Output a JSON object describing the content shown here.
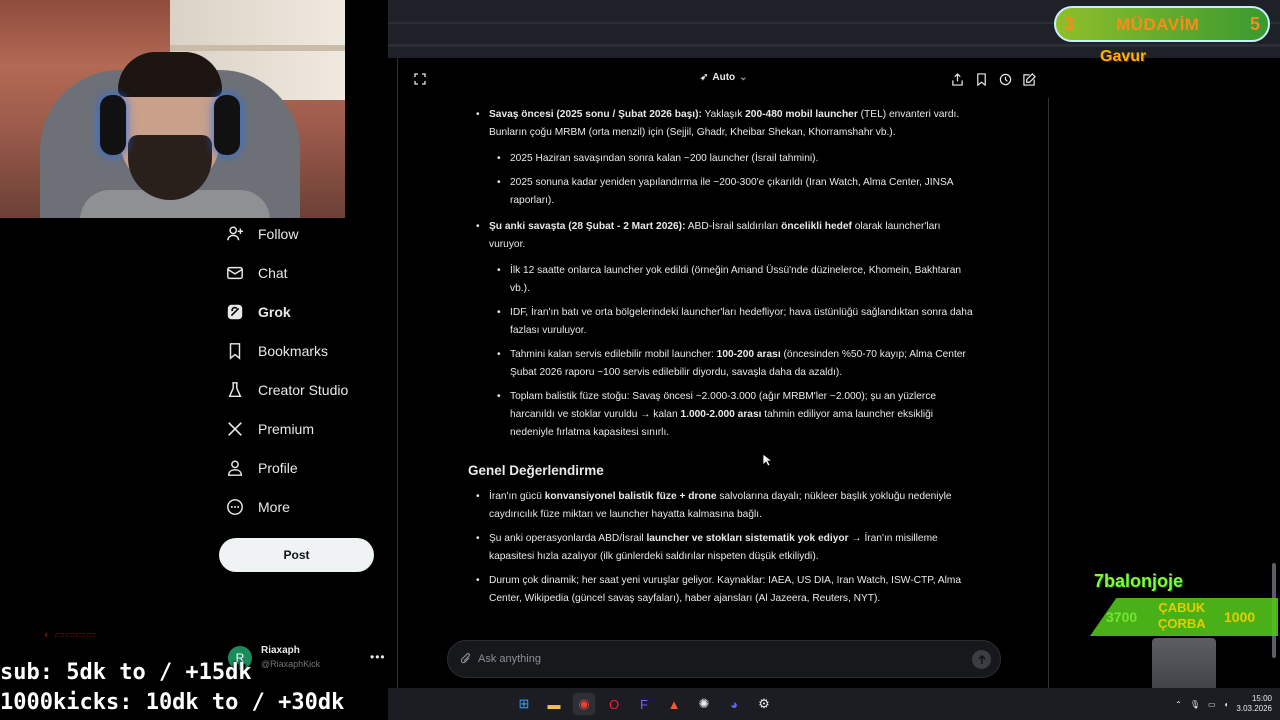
{
  "nav": {
    "items": [
      {
        "label": "Follow",
        "icon": "follow-icon"
      },
      {
        "label": "Chat",
        "icon": "mail-icon"
      },
      {
        "label": "Grok",
        "icon": "grok-icon",
        "active": true
      },
      {
        "label": "Bookmarks",
        "icon": "bookmark-icon"
      },
      {
        "label": "Creator Studio",
        "icon": "flask-icon"
      },
      {
        "label": "Premium",
        "icon": "x-logo-icon"
      },
      {
        "label": "Profile",
        "icon": "person-icon"
      },
      {
        "label": "More",
        "icon": "more-circle-icon"
      }
    ],
    "post_label": "Post"
  },
  "account": {
    "initial": "R",
    "name": "Riaxaph",
    "handle": "@RiaxaphKick"
  },
  "toolbar": {
    "model": "Auto"
  },
  "response": {
    "item1_bold": "Savaş öncesi (2025 sonu / Şubat 2026 başı):",
    "item1_text1": " Yaklaşık ",
    "item1_bold2": "200-480 mobil launcher",
    "item1_text2": " (TEL) envanteri vardı. Bunların çoğu MRBM (orta menzil) için (Sejjil, Ghadr, Kheibar Shekan, Khorramshahr vb.).",
    "item1_sub1": "2025 Haziran savaşından sonra kalan ~200 launcher (İsrail tahmini).",
    "item1_sub2": "2025 sonuna kadar yeniden yapılandırma ile ~200-300'e çıkarıldı (Iran Watch, Alma Center, JINSA raporları).",
    "item2_bold": "Şu anki savaşta (28 Şubat - 2 Mart 2026):",
    "item2_text1": " ABD-İsrail saldırıları ",
    "item2_bold2": "öncelikli hedef",
    "item2_text2": " olarak launcher'ları vuruyor.",
    "item2_sub1": "İlk 12 saatte onlarca launcher yok edildi (örneğin Amand Üssü'nde düzinelerce, Khomein, Bakhtaran vb.).",
    "item2_sub2": "IDF, İran'ın batı ve orta bölgelerindeki launcher'ları hedefliyor; hava üstünlüğü sağlandıktan sonra daha fazlası vuruluyor.",
    "item2_sub3_text1": "Tahmini kalan servis edilebilir mobil launcher: ",
    "item2_sub3_bold": "100-200 arası",
    "item2_sub3_text2": " (öncesinden %50-70 kayıp; Alma Center Şubat 2026 raporu ~100 servis edilebilir diyordu, savaşla daha da azaldı).",
    "item2_sub4_text1": "Toplam balistik füze stoğu: Savaş öncesi ~2.000-3.000 (ağır MRBM'ler ~2.000); şu an yüzlerce harcanıldı ve stoklar vuruldu → kalan ",
    "item2_sub4_bold": "1.000-2.000 arası",
    "item2_sub4_text2": " tahmin ediliyor ama launcher eksikliği nedeniyle fırlatma kapasitesi sınırlı.",
    "heading": "Genel Değerlendirme",
    "g1_text1": "İran'ın gücü ",
    "g1_bold": "konvansiyonel balistik füze + drone",
    "g1_text2": " salvolarına dayalı; nükleer başlık yokluğu nedeniyle caydırıcılık füze miktarı ve launcher hayatta kalmasına bağlı.",
    "g2_text1": "Şu anki operasyonlarda ABD/İsrail ",
    "g2_bold": "launcher ve stokları sistematik yok ediyor",
    "g2_text2": " → İran'ın misilleme kapasitesi hızla azalıyor (ilk günlerdeki saldırılar nispeten düşük etkiliydi).",
    "g3_text": "Durum çok dinamik; her saat yeni vuruşlar geliyor. Kaynaklar: IAEA, US DIA, Iran Watch, ISW-CTP, Alma Center, Wikipedia (güncel savaş sayfaları), haber ajansları (Al Jazeera, Reuters, NYT)."
  },
  "ask": {
    "placeholder": "Ask anything"
  },
  "overlay": {
    "sub": "sub: 5dk to / +15dk",
    "kicks": "1000kicks: 10dk to / +30dk",
    "badge_left": "3",
    "badge_title": "MÜDAVİM",
    "badge_right": "5",
    "badge_sub": "Gavur",
    "green_name": "7balonjoje",
    "green_left": "3700",
    "green_title1": "ÇABUK",
    "green_title2": "ÇORBA",
    "green_right": "1000"
  },
  "taskbar": {
    "time": "15:00",
    "date": "3.03.2026"
  }
}
